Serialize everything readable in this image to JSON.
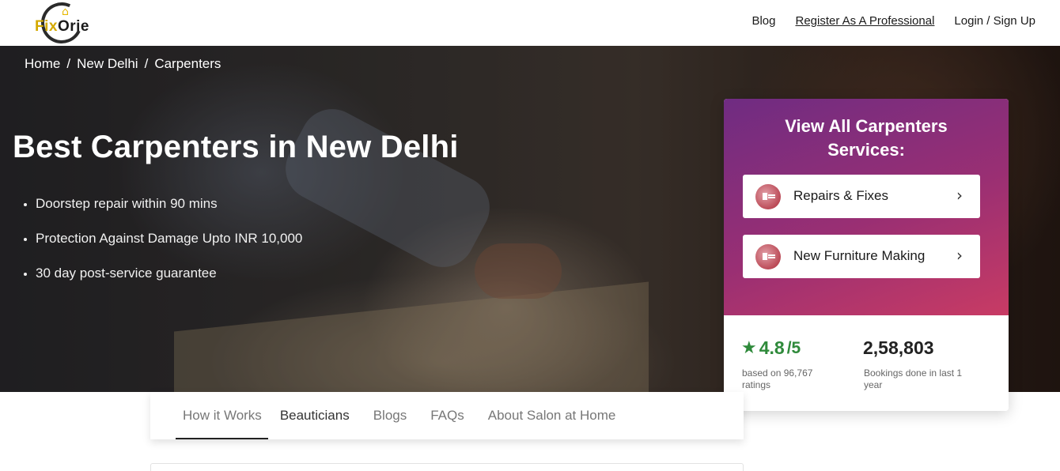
{
  "header": {
    "logo": {
      "text_fix": "Fix",
      "text_orie": "Orie"
    },
    "nav": [
      {
        "label": "Blog"
      },
      {
        "label": "Register As A Professional"
      },
      {
        "label": "Login / Sign Up"
      }
    ]
  },
  "hero": {
    "breadcrumb": [
      "Home",
      "New Delhi",
      "Carpenters"
    ],
    "breadcrumb_sep": "/",
    "title": "Best Carpenters in New Delhi",
    "features": [
      "Doorstep repair within 90 mins",
      "Protection Against Damage Upto INR 10,000",
      "30 day post-service guarantee"
    ]
  },
  "side_card": {
    "title_line1": "View All Carpenters",
    "title_line2": "Services:",
    "services": [
      {
        "label": "Repairs & Fixes",
        "icon": "repair-service-icon"
      },
      {
        "label": "New Furniture Making",
        "icon": "furniture-service-icon"
      }
    ],
    "chevron": "›",
    "rating": {
      "value": "4.8",
      "denom": "/5",
      "star": "★",
      "sub": "based on 96,767 ratings"
    },
    "bookings": {
      "value": "2,58,803",
      "sub": "Bookings done in last 1 year"
    },
    "colors": {
      "gradient_start": "#6f2c82",
      "gradient_end": "#c83b64",
      "rating_green": "#2f8a3b"
    }
  },
  "tabs": [
    {
      "label": "How it Works",
      "active": true
    },
    {
      "label": "Beauticians"
    },
    {
      "label": "Blogs"
    },
    {
      "label": "FAQs"
    },
    {
      "label": "About Salon at Home"
    }
  ]
}
